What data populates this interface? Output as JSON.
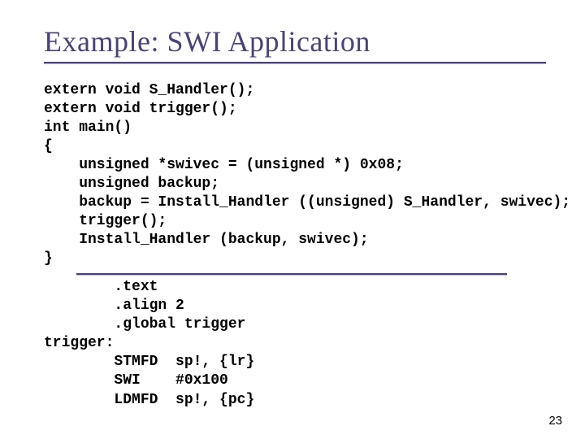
{
  "title": "Example: SWI Application",
  "code_c": "extern void S_Handler();\nextern void trigger();\nint main()\n{\n    unsigned *swivec = (unsigned *) 0x08;\n    unsigned backup;\n    backup = Install_Handler ((unsigned) S_Handler, swivec);\n    trigger();\n    Install_Handler (backup, swivec);\n}",
  "code_asm": "        .text\n        .align 2\n        .global trigger\ntrigger:\n        STMFD  sp!, {lr}\n        SWI    #0x100\n        LDMFD  sp!, {pc}",
  "page_number": "23"
}
